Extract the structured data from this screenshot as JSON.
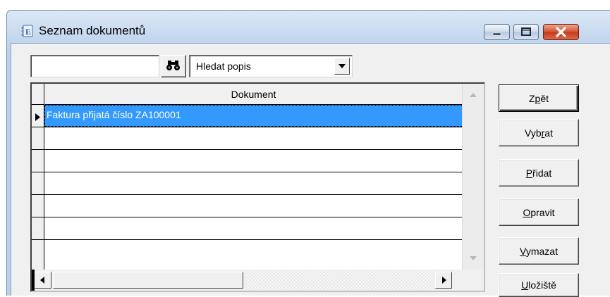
{
  "window": {
    "title": "Seznam dokumentů",
    "icon": "document-e-icon"
  },
  "toolbar": {
    "search_value": "",
    "search_placeholder": "",
    "find_icon": "binoculars-icon",
    "search_mode_selected": "Hledat popis"
  },
  "grid": {
    "columns": [
      "Dokument"
    ],
    "rows": [
      {
        "text": "Faktura přijatá číslo ZA100001",
        "selected": true
      },
      {
        "text": "",
        "selected": false
      },
      {
        "text": "",
        "selected": false
      },
      {
        "text": "",
        "selected": false
      },
      {
        "text": "",
        "selected": false
      },
      {
        "text": "",
        "selected": false
      },
      {
        "text": "",
        "selected": false
      }
    ]
  },
  "buttons": {
    "back": {
      "pre": "Z",
      "key": "p",
      "post": "ět"
    },
    "select": {
      "pre": "Vyb",
      "key": "r",
      "post": "at"
    },
    "add": {
      "pre": "",
      "key": "P",
      "post": "řidat"
    },
    "edit": {
      "pre": "",
      "key": "O",
      "post": "pravit"
    },
    "delete": {
      "pre": "",
      "key": "V",
      "post": "ymazat"
    },
    "storage": {
      "pre": "",
      "key": "U",
      "post": "ložiště"
    }
  },
  "colors": {
    "selection": "#3399ff",
    "client_bg": "#f0f0f0",
    "close_button": "#c33a18"
  }
}
